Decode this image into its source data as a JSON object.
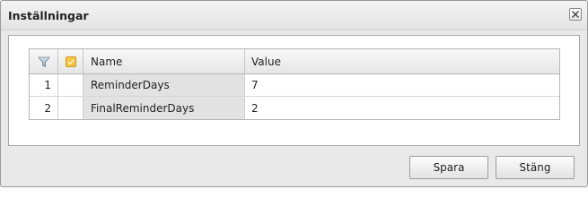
{
  "dialog": {
    "title": "Inställningar",
    "close_icon": "close-icon"
  },
  "grid": {
    "columns": {
      "filter_icon": "filter-icon",
      "select_icon": "checkbox-column-icon",
      "name": "Name",
      "value": "Value"
    },
    "rows": [
      {
        "num": "1",
        "name": "ReminderDays",
        "value": "7"
      },
      {
        "num": "2",
        "name": "FinalReminderDays",
        "value": "2"
      }
    ]
  },
  "footer": {
    "save_label": "Spara",
    "close_label": "Stäng"
  }
}
